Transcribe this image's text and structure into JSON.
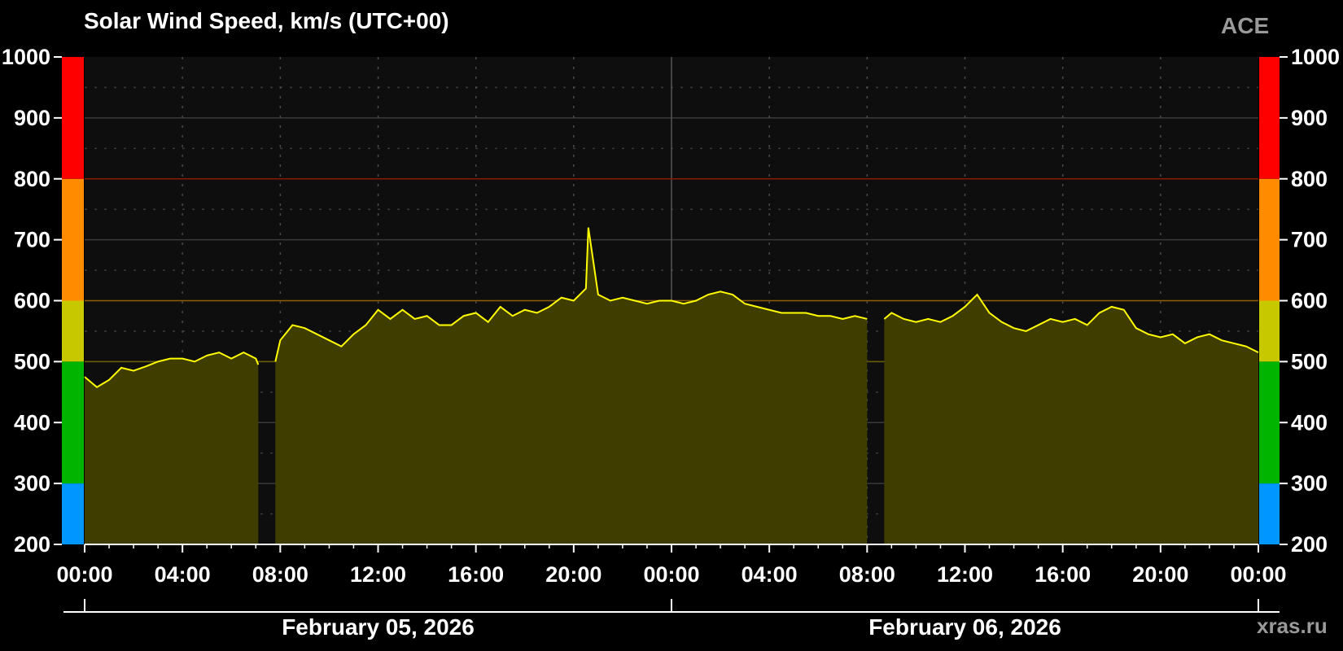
{
  "header": {
    "title": "Solar Wind Speed, km/s (UTC+00)",
    "source": "ACE",
    "site": "xras.ru"
  },
  "chart_data": {
    "type": "area",
    "title": "Solar Wind Speed, km/s (UTC+00)",
    "xlabel": "",
    "ylabel": "",
    "ylim": [
      200,
      1000
    ],
    "xlim_hours": [
      0,
      48
    ],
    "y_ticks": [
      200,
      300,
      400,
      500,
      600,
      700,
      800,
      900,
      1000
    ],
    "x_ticks": [
      {
        "hour": 0,
        "label": "00:00"
      },
      {
        "hour": 4,
        "label": "04:00"
      },
      {
        "hour": 8,
        "label": "08:00"
      },
      {
        "hour": 12,
        "label": "12:00"
      },
      {
        "hour": 16,
        "label": "16:00"
      },
      {
        "hour": 20,
        "label": "20:00"
      },
      {
        "hour": 24,
        "label": "00:00"
      },
      {
        "hour": 28,
        "label": "04:00"
      },
      {
        "hour": 32,
        "label": "08:00"
      },
      {
        "hour": 36,
        "label": "12:00"
      },
      {
        "hour": 40,
        "label": "16:00"
      },
      {
        "hour": 44,
        "label": "20:00"
      },
      {
        "hour": 48,
        "label": "00:00"
      }
    ],
    "dates": [
      {
        "label": "February 05, 2026",
        "center_hour": 12
      },
      {
        "label": "February 06, 2026",
        "center_hour": 36
      }
    ],
    "grid": true,
    "legend": "none",
    "colors": {
      "line": "#ffff00",
      "fill": "#403d00",
      "plot_bg": "#0e0e0e",
      "grid": "#3a3a3a",
      "line_500": "#6b6000",
      "line_600": "#8a5a00",
      "line_800": "#8a1a00"
    },
    "threshold_bands": [
      {
        "from": 200,
        "to": 300,
        "color": "#0096ff"
      },
      {
        "from": 300,
        "to": 500,
        "color": "#00b400"
      },
      {
        "from": 500,
        "to": 600,
        "color": "#c8c800"
      },
      {
        "from": 600,
        "to": 800,
        "color": "#ff8c00"
      },
      {
        "from": 800,
        "to": 1000,
        "color": "#ff0000"
      }
    ],
    "series": [
      {
        "x_hours": [
          0,
          0.5,
          1,
          1.5,
          2,
          2.5,
          3,
          3.5,
          4,
          4.5,
          5,
          5.5,
          6,
          6.5,
          7,
          7.1,
          7.8,
          8,
          8.5,
          9,
          9.5,
          10,
          10.5,
          11,
          11.5,
          12,
          12.5,
          13,
          13.5,
          14,
          14.5,
          15,
          15.5,
          16,
          16.5,
          17,
          17.5,
          18,
          18.5,
          19,
          19.5,
          20,
          20.5,
          20.6,
          21,
          21.5,
          22,
          22.5,
          23,
          23.5,
          24,
          24.5,
          25,
          25.5,
          26,
          26.5,
          27,
          27.5,
          28,
          28.5,
          29,
          29.5,
          30,
          30.5,
          31,
          31.5,
          32,
          32.7,
          33,
          33.5,
          34,
          34.5,
          35,
          35.5,
          36,
          36.5,
          37,
          37.5,
          38,
          38.5,
          39,
          39.5,
          40,
          40.5,
          41,
          41.5,
          42,
          42.5,
          43,
          43.5,
          44,
          44.5,
          45,
          45.5,
          46,
          46.5,
          47,
          47.5,
          48
        ],
        "y": [
          475,
          458,
          470,
          490,
          485,
          492,
          500,
          505,
          505,
          500,
          510,
          515,
          505,
          515,
          505,
          495,
          500,
          535,
          560,
          555,
          545,
          535,
          525,
          545,
          560,
          585,
          570,
          585,
          570,
          575,
          560,
          560,
          575,
          580,
          565,
          590,
          575,
          585,
          580,
          590,
          605,
          600,
          620,
          720,
          610,
          600,
          605,
          600,
          595,
          600,
          600,
          595,
          600,
          610,
          615,
          610,
          595,
          590,
          585,
          580,
          580,
          580,
          575,
          575,
          570,
          575,
          570,
          570,
          580,
          570,
          565,
          570,
          565,
          575,
          590,
          610,
          580,
          565,
          555,
          550,
          560,
          570,
          565,
          570,
          560,
          580,
          590,
          585,
          555,
          545,
          540,
          545,
          530,
          540,
          545,
          535,
          530,
          525,
          515,
          505,
          515,
          510
        ]
      }
    ]
  }
}
